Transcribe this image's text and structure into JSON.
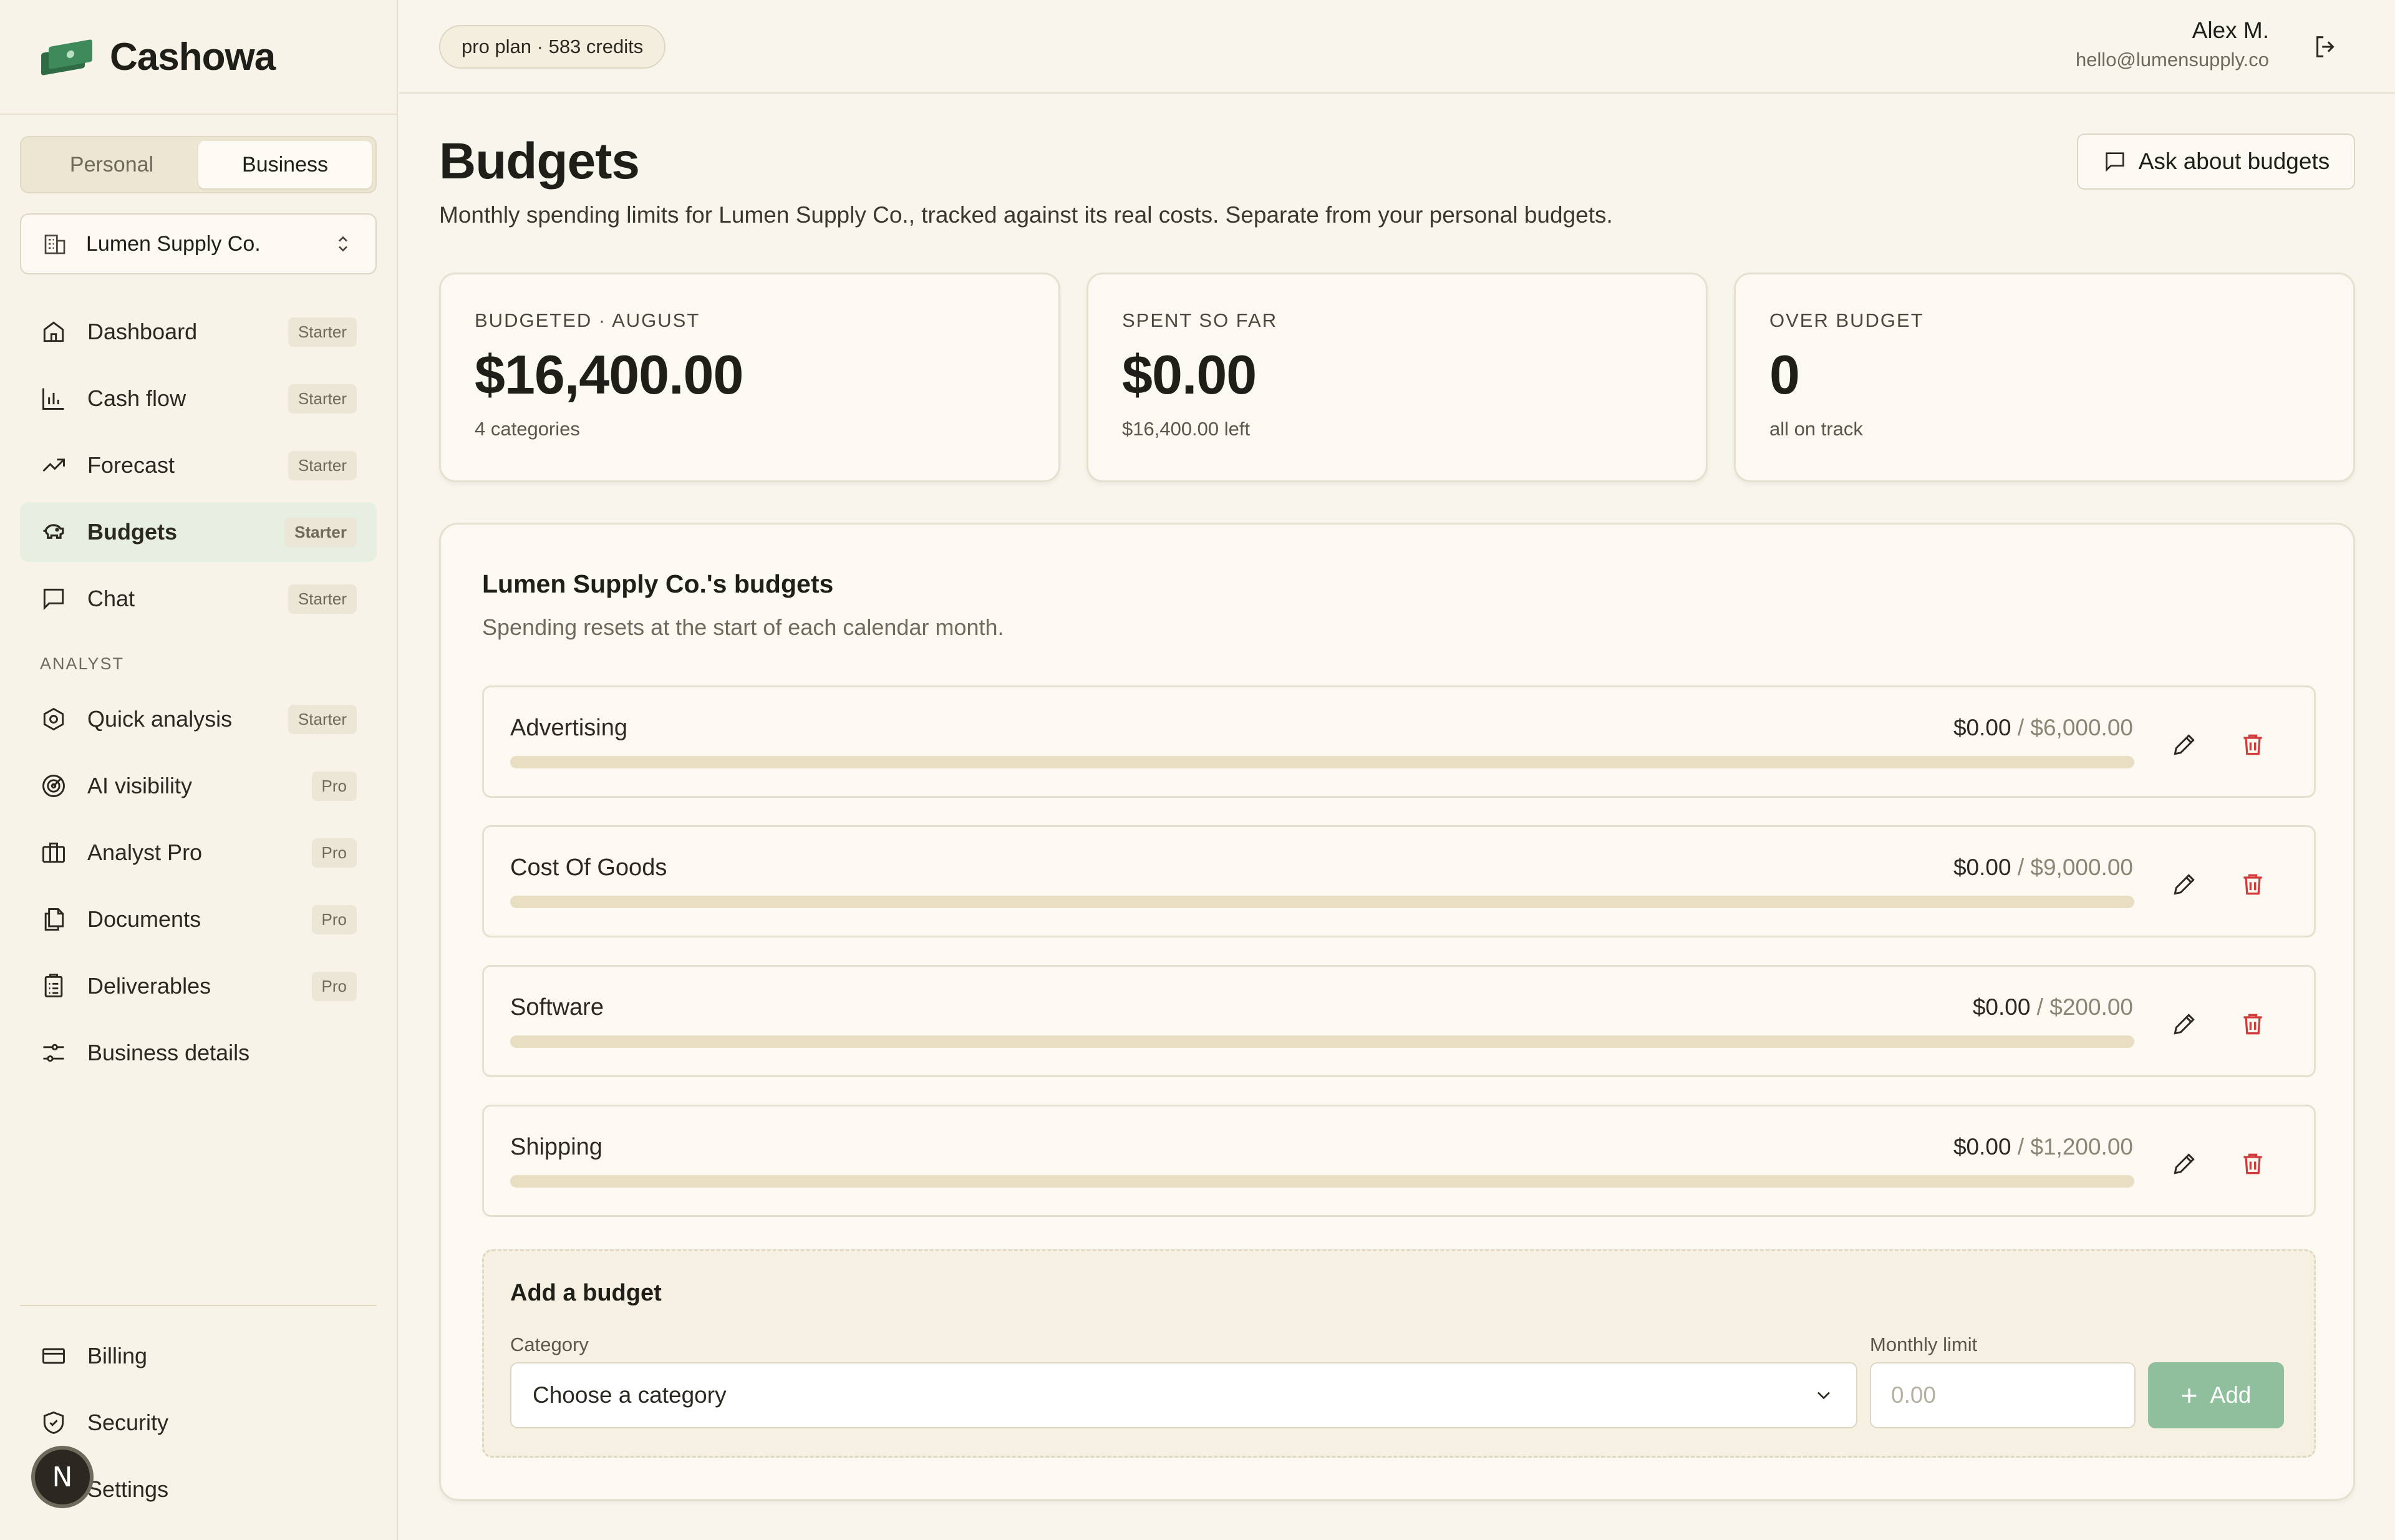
{
  "app": {
    "name": "Cashowa"
  },
  "mode_toggle": {
    "options": [
      "Personal",
      "Business"
    ],
    "selected": "Business"
  },
  "business_selector": {
    "value": "Lumen Supply Co."
  },
  "nav": {
    "main": [
      {
        "label": "Dashboard",
        "badge": "Starter",
        "icon": "home-icon"
      },
      {
        "label": "Cash flow",
        "badge": "Starter",
        "icon": "bar-chart-icon"
      },
      {
        "label": "Forecast",
        "badge": "Starter",
        "icon": "trend-up-icon"
      },
      {
        "label": "Budgets",
        "badge": "Starter",
        "icon": "piggy-bank-icon",
        "active": true
      },
      {
        "label": "Chat",
        "badge": "Starter",
        "icon": "chat-icon"
      }
    ],
    "analyst_label": "ANALYST",
    "analyst": [
      {
        "label": "Quick analysis",
        "badge": "Starter",
        "icon": "hexagon-icon"
      },
      {
        "label": "AI visibility",
        "badge": "Pro",
        "icon": "target-icon"
      },
      {
        "label": "Analyst Pro",
        "badge": "Pro",
        "icon": "briefcase-icon"
      },
      {
        "label": "Documents",
        "badge": "Pro",
        "icon": "documents-icon"
      },
      {
        "label": "Deliverables",
        "badge": "Pro",
        "icon": "clipboard-icon"
      },
      {
        "label": "Business details",
        "badge": "",
        "icon": "sliders-icon"
      }
    ],
    "bottom": [
      {
        "label": "Billing",
        "icon": "credit-card-icon"
      },
      {
        "label": "Security",
        "icon": "shield-icon"
      },
      {
        "label": "Settings",
        "icon": "gear-icon"
      }
    ]
  },
  "avatar": {
    "initial": "N"
  },
  "topbar": {
    "plan": "pro plan · 583 credits",
    "user_name": "Alex M.",
    "user_email": "hello@lumensupply.co"
  },
  "page": {
    "title": "Budgets",
    "subtitle": "Monthly spending limits for Lumen Supply Co., tracked against its real costs. Separate from your personal budgets.",
    "ask_button": "Ask about budgets"
  },
  "stats": [
    {
      "label": "BUDGETED · AUGUST",
      "value": "$16,400.00",
      "sub": "4 categories"
    },
    {
      "label": "SPENT SO FAR",
      "value": "$0.00",
      "sub": "$16,400.00 left"
    },
    {
      "label": "OVER BUDGET",
      "value": "0",
      "sub": "all on track"
    }
  ],
  "budgets": {
    "title": "Lumen Supply Co.'s budgets",
    "subtitle": "Spending resets at the start of each calendar month.",
    "separator": " / ",
    "items": [
      {
        "category": "Advertising",
        "spent": "$0.00",
        "limit": "$6,000.00",
        "progress": 0
      },
      {
        "category": "Cost Of Goods",
        "spent": "$0.00",
        "limit": "$9,000.00",
        "progress": 0
      },
      {
        "category": "Software",
        "spent": "$0.00",
        "limit": "$200.00",
        "progress": 0
      },
      {
        "category": "Shipping",
        "spent": "$0.00",
        "limit": "$1,200.00",
        "progress": 0
      }
    ]
  },
  "add_budget": {
    "title": "Add a budget",
    "category_label": "Category",
    "category_value": "Choose a category",
    "limit_label": "Monthly limit",
    "limit_placeholder": "0.00",
    "add_label": "Add"
  },
  "colors": {
    "background": "#f8f5ec",
    "accent_green": "#8fbf9d",
    "active_nav": "#e7eee2",
    "delete_red": "#d33a3a",
    "progress_track": "#e8dec2"
  }
}
